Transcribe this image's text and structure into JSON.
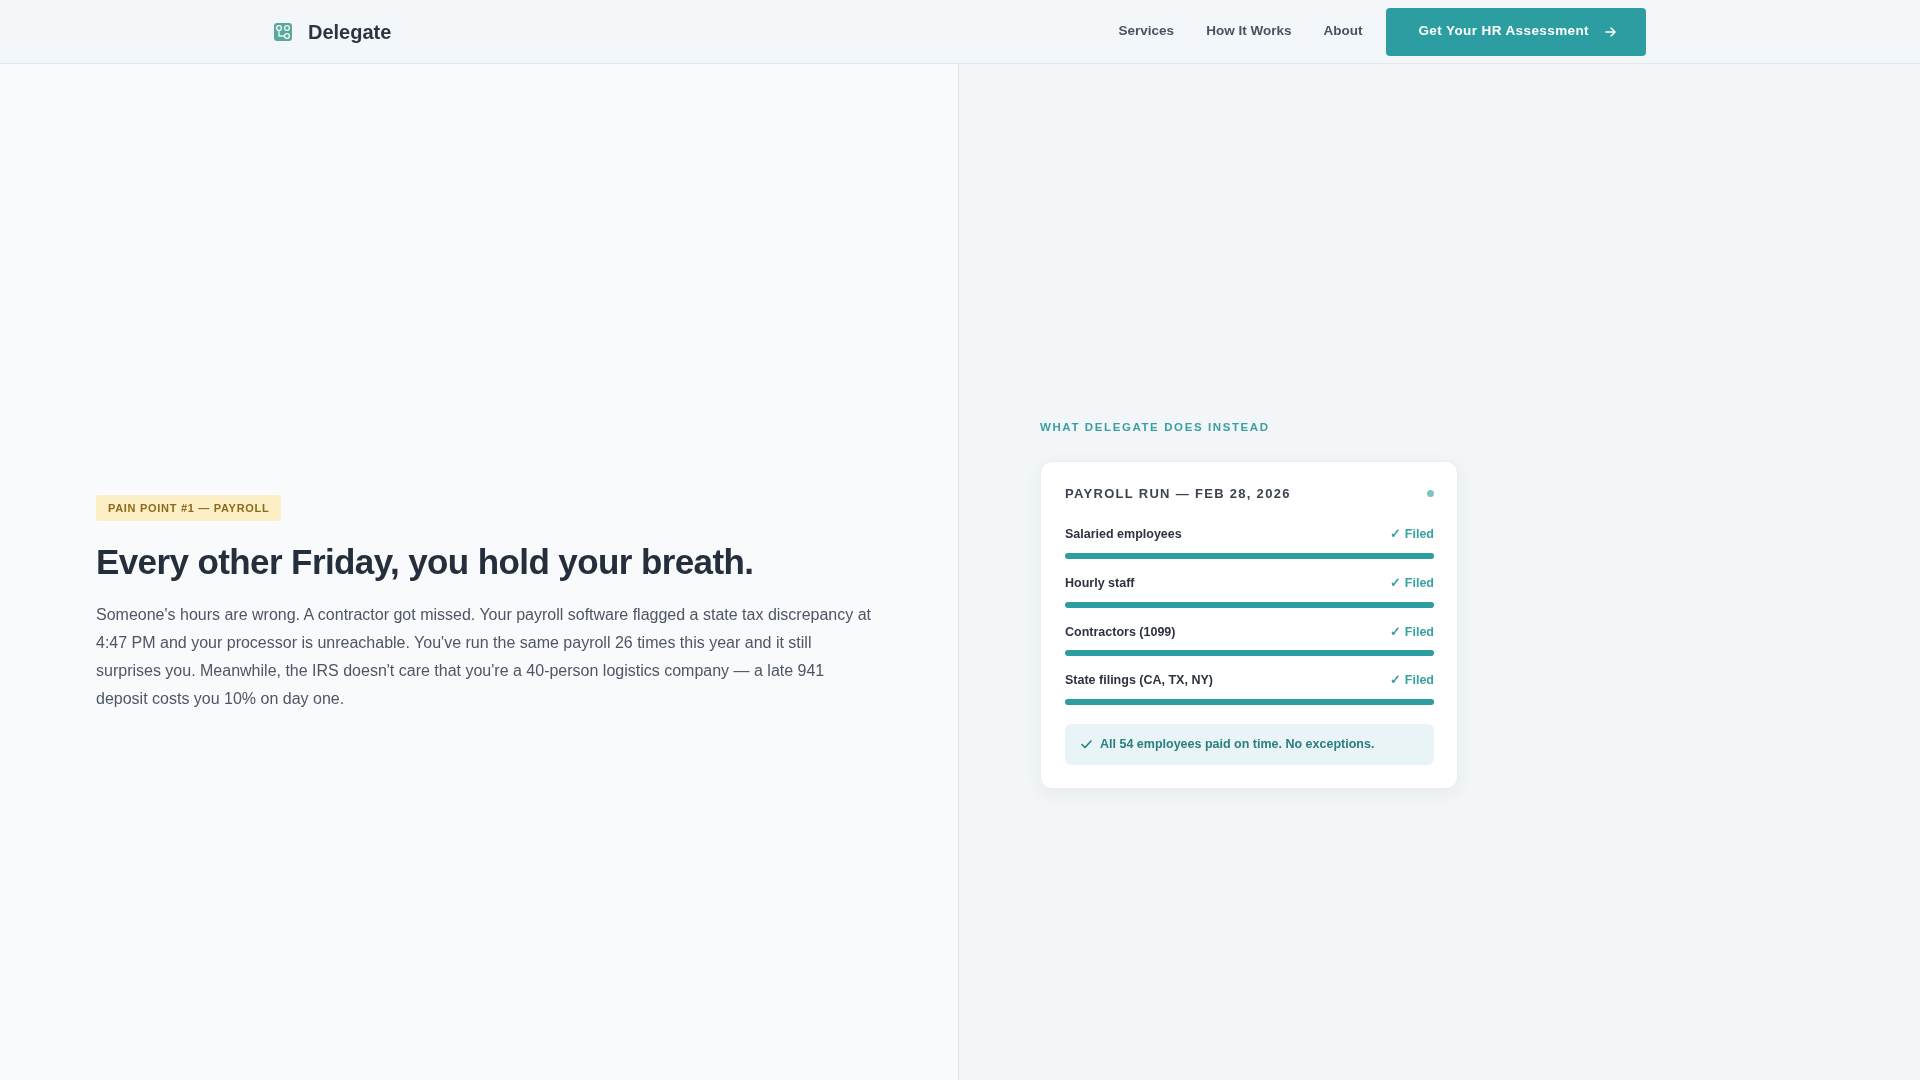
{
  "nav": {
    "brand": "Delegate",
    "links": [
      "Services",
      "How It Works",
      "About"
    ],
    "cta": "Get Your HR Assessment"
  },
  "problem": {
    "badge": "PAIN POINT #1 — PAYROLL",
    "heading": "Every other Friday, you hold your breath.",
    "body": "Someone's hours are wrong. A contractor got missed. Your payroll software flagged a state tax discrepancy at 4:47 PM and your processor is unreachable. You've run the same payroll 26 times this year and it still surprises you. Meanwhile, the IRS doesn't care that you're a 40-person logistics company — a late 941 deposit costs you 10% on day one."
  },
  "solution": {
    "label": "WHAT DELEGATE DOES INSTEAD",
    "card": {
      "title": "PAYROLL RUN — FEB 28, 2026",
      "rows": [
        {
          "name": "Salaried employees",
          "status": "✓ Filed",
          "level": 1
        },
        {
          "name": "Hourly staff",
          "status": "✓ Filed",
          "level": 1
        },
        {
          "name": "Contractors (1099)",
          "status": "✓ Filed",
          "level": 1
        },
        {
          "name": "State filings (CA, TX, NY)",
          "status": "✓ Filed",
          "level": 1
        }
      ],
      "summary": "All 54 employees paid on time. No exceptions."
    }
  }
}
